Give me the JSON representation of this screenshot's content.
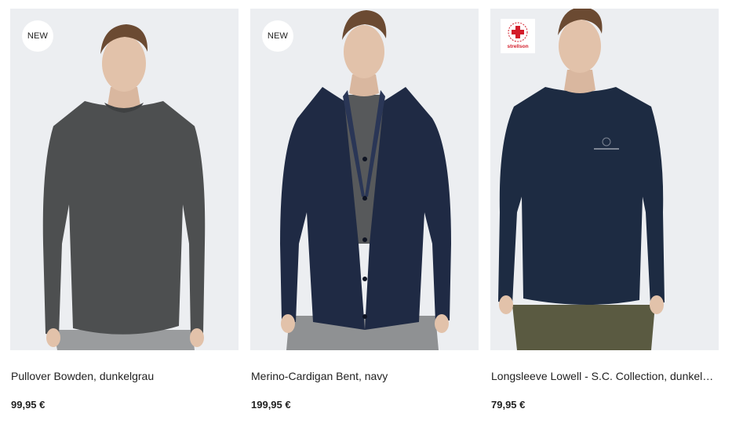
{
  "products": [
    {
      "badge": "NEW",
      "title": "Pullover Bowden, dunkelgrau",
      "price": "99,95 €",
      "garment_color": "#4d4f50"
    },
    {
      "badge": "NEW",
      "title": "Merino-Cardigan Bent, navy",
      "price": "199,95 €",
      "garment_color": "#1f2a44"
    },
    {
      "brand_badge": "strellson",
      "title": "Longsleeve Lowell - S.C. Collection, dunkel…",
      "price": "79,95 €",
      "garment_color": "#1d2b42"
    }
  ],
  "colors": {
    "photo_background": "#eceef1",
    "brand_red": "#d31c2a",
    "text": "#222222"
  }
}
